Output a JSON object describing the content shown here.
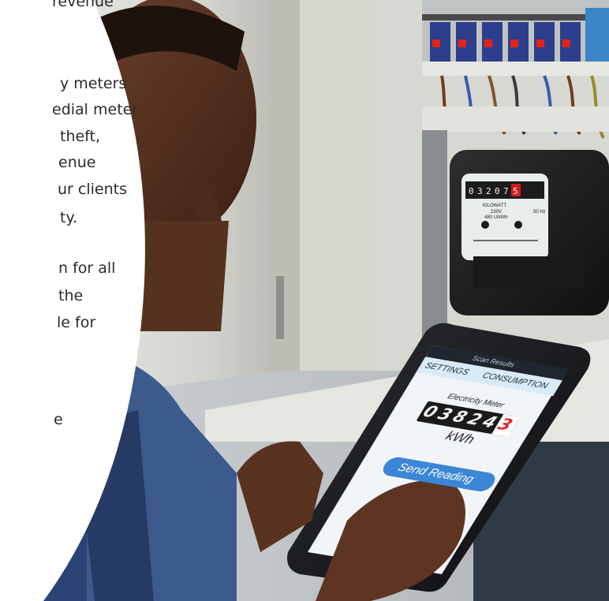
{
  "overlay_text": {
    "lines": [
      "revenue",
      "y meters",
      "edial meter",
      "theft,",
      "enue",
      "ur clients",
      "ty.",
      "n for all",
      "the",
      "le for",
      "e"
    ]
  },
  "tablet_app": {
    "header_title": "Scan Results",
    "tabs": [
      {
        "label": "SETTINGS"
      },
      {
        "label": "CONSUMPTION"
      }
    ],
    "meter": {
      "title": "Electricity Meter",
      "digits": [
        "0",
        "3",
        "8",
        "2",
        "4",
        "3"
      ],
      "unit": "kWh"
    },
    "send_button_label": "Send Reading"
  },
  "physical_meter": {
    "dial_digits": [
      "0",
      "3",
      "2",
      "0",
      "7",
      "5"
    ],
    "brand_label": "KILOWATT",
    "voltage_label": "230V",
    "rate_label": "480 U/kWh",
    "frequency_label": "50 Hz"
  },
  "colors": {
    "screen_header": "#1f2630",
    "tab_bar": "#d9ebf7",
    "send_button": "#3b86d6",
    "last_digit": "#e0262a"
  }
}
